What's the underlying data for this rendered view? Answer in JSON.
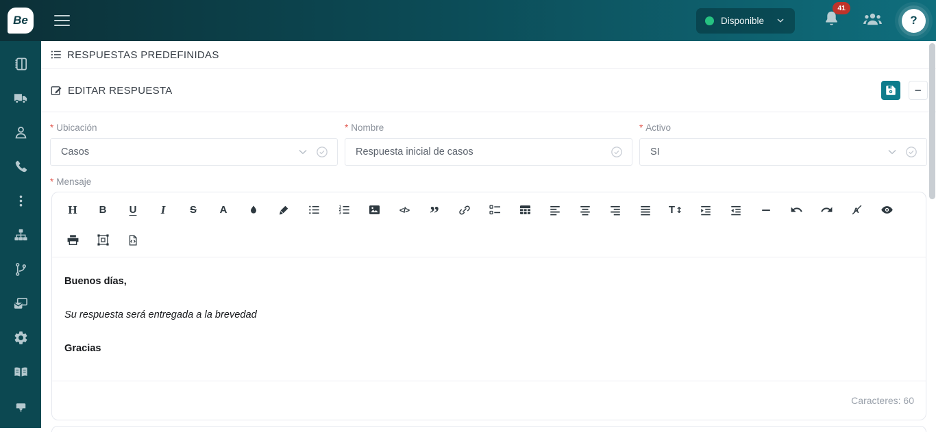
{
  "topbar": {
    "logo_text": "Be",
    "status_label": "Disponible",
    "notification_count": "41",
    "help_glyph": "?",
    "icons": [
      "menu-hamburger",
      "status-dot-green",
      "chevron-down",
      "bell",
      "users-group",
      "help-question"
    ],
    "colors": {
      "status_dot": "#26c281",
      "badge_red": "#bf332a",
      "bar_gradient_left": "#0c3037",
      "bar_gradient_right": "#0f6e7d"
    }
  },
  "sidebar": {
    "icons": [
      "contacts-notebook",
      "truck",
      "user",
      "phone",
      "more-dots",
      "sitemap",
      "branch",
      "mail-screen",
      "settings-gear",
      "open-book",
      "plug"
    ],
    "color": "#0c4851"
  },
  "page": {
    "title": "RESPUESTAS PREDEFINIDAS"
  },
  "panel": {
    "title": "EDITAR RESPUESTA",
    "actions": [
      "save",
      "collapse"
    ],
    "accent_color": "#0e7c8c"
  },
  "form": {
    "required_mark": "*",
    "ubicacion": {
      "label": "Ubicación",
      "value": "Casos"
    },
    "nombre": {
      "label": "Nombre",
      "value": "Respuesta inicial de casos"
    },
    "activo": {
      "label": "Activo",
      "value": "SI"
    },
    "mensaje_label": "Mensaje"
  },
  "editor": {
    "glyphs": {
      "header": "H",
      "bold": "B",
      "underline": "U",
      "italic": "I",
      "strikethrough": "S",
      "font_color": "A",
      "code_view": "</>",
      "blockquote": "”",
      "font_size_t": "T",
      "font_size_arrows": "↕"
    },
    "toolbar_row1": [
      "header",
      "bold",
      "underline",
      "italic",
      "strikethrough",
      "font-color",
      "ink-drop",
      "highlighter",
      "bullet-list",
      "numbered-list",
      "insert-image",
      "code-view",
      "blockquote",
      "insert-link",
      "task-list",
      "insert-table",
      "align-left",
      "align-center",
      "align-right",
      "align-justify",
      "font-size",
      "indent",
      "outdent",
      "horizontal-rule",
      "undo",
      "redo",
      "clear-format",
      "preview-eye"
    ],
    "toolbar_row2": [
      "print",
      "frame-select",
      "code-file"
    ],
    "content": [
      {
        "style": "bold",
        "text": "Buenos días,"
      },
      {
        "style": "italic",
        "text": "Su respuesta será entregada a la brevedad"
      },
      {
        "style": "bold",
        "text": "Gracias"
      }
    ],
    "char_counter": "Caracteres: 60"
  }
}
